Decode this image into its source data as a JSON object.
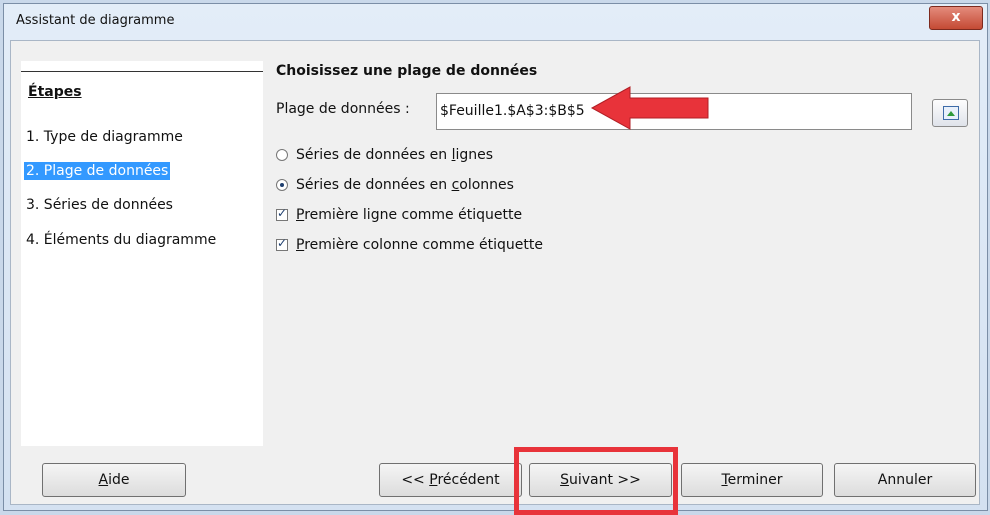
{
  "window": {
    "title": "Assistant de diagramme",
    "close_label": "x"
  },
  "steps": {
    "heading": "Étapes",
    "items": [
      {
        "label": "1. Type de diagramme"
      },
      {
        "label": "2. Plage de données"
      },
      {
        "label": "3. Séries de données"
      },
      {
        "label": "4. Éléments du diagramme"
      }
    ]
  },
  "panel": {
    "title": "Choisissez une plage de données",
    "range_label": "Plage de données :",
    "range_value": "$Feuille1.$A$3:$B$5"
  },
  "options": {
    "rows_label_pre": "Séries de données en ",
    "rows_label_key": "l",
    "rows_label_post": "ignes",
    "cols_label_pre": "Séries de données en ",
    "cols_label_key": "c",
    "cols_label_post": "olonnes",
    "first_row_key": "P",
    "first_row_post": "remière ligne comme étiquette",
    "first_col_key": "P",
    "first_col_post": "remière colonne comme étiquette"
  },
  "buttons": {
    "help_key": "A",
    "help_post": "ide",
    "prev_pre": "<< ",
    "prev_key": "P",
    "prev_post": "récédent",
    "next_key": "S",
    "next_post": "uivant >>",
    "finish_key": "T",
    "finish_post": "erminer",
    "cancel": "Annuler"
  },
  "colors": {
    "accent": "#3399ff",
    "annotation": "#e8333a"
  },
  "icons": {
    "range_button": "select-range-icon",
    "close": "close-icon"
  }
}
